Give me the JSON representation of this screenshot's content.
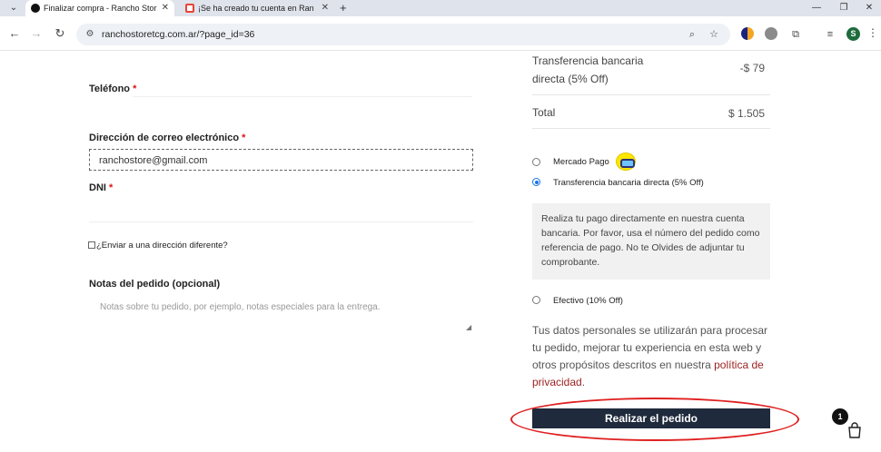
{
  "browser": {
    "tabs": [
      {
        "title": "Finalizar compra - Rancho Stor",
        "active": true
      },
      {
        "title": "¡Se ha creado tu cuenta en Ran",
        "active": false
      }
    ],
    "url": "ranchostoretcg.com.ar/?page_id=36",
    "profile_initial": "S"
  },
  "form": {
    "telefono_label": "Teléfono",
    "email_label": "Dirección de correo electrónico",
    "email_value": "ranchostore@gmail.com",
    "dni_label": "DNI",
    "required_mark": "*",
    "ship_different_label": "¿Enviar a una dirección diferente?",
    "notes_label": "Notas del pedido (opcional)",
    "notes_placeholder": "Notas sobre tu pedido, por ejemplo, notas especiales para la entrega."
  },
  "summary": {
    "discount_label": "Transferencia bancaria directa (5% Off)",
    "discount_value": "-$ 79",
    "total_label": "Total",
    "total_value": "$ 1.505"
  },
  "payment": {
    "options": [
      {
        "label": "Mercado Pago",
        "selected": false
      },
      {
        "label": "Transferencia bancaria directa (5% Off)",
        "selected": true
      },
      {
        "label": "Efectivo (10% Off)",
        "selected": false
      }
    ],
    "transfer_description": "Realiza tu pago directamente en nuestra cuenta bancaria. Por favor, usa el número del pedido como referencia de pago. No te Olvides de adjuntar tu comprobante."
  },
  "privacy": {
    "text": "Tus datos personales se utilizarán para procesar tu pedido, mejorar tu experiencia en esta web y otros propósitos descritos en nuestra",
    "link": "política de privacidad",
    "end": "."
  },
  "submit_label": "Realizar el pedido",
  "cart_count": "1",
  "colors": {
    "accent": "#1f2a3c",
    "link": "#9c1f1f",
    "required": "#dd1111",
    "annotation": "#e02020"
  }
}
